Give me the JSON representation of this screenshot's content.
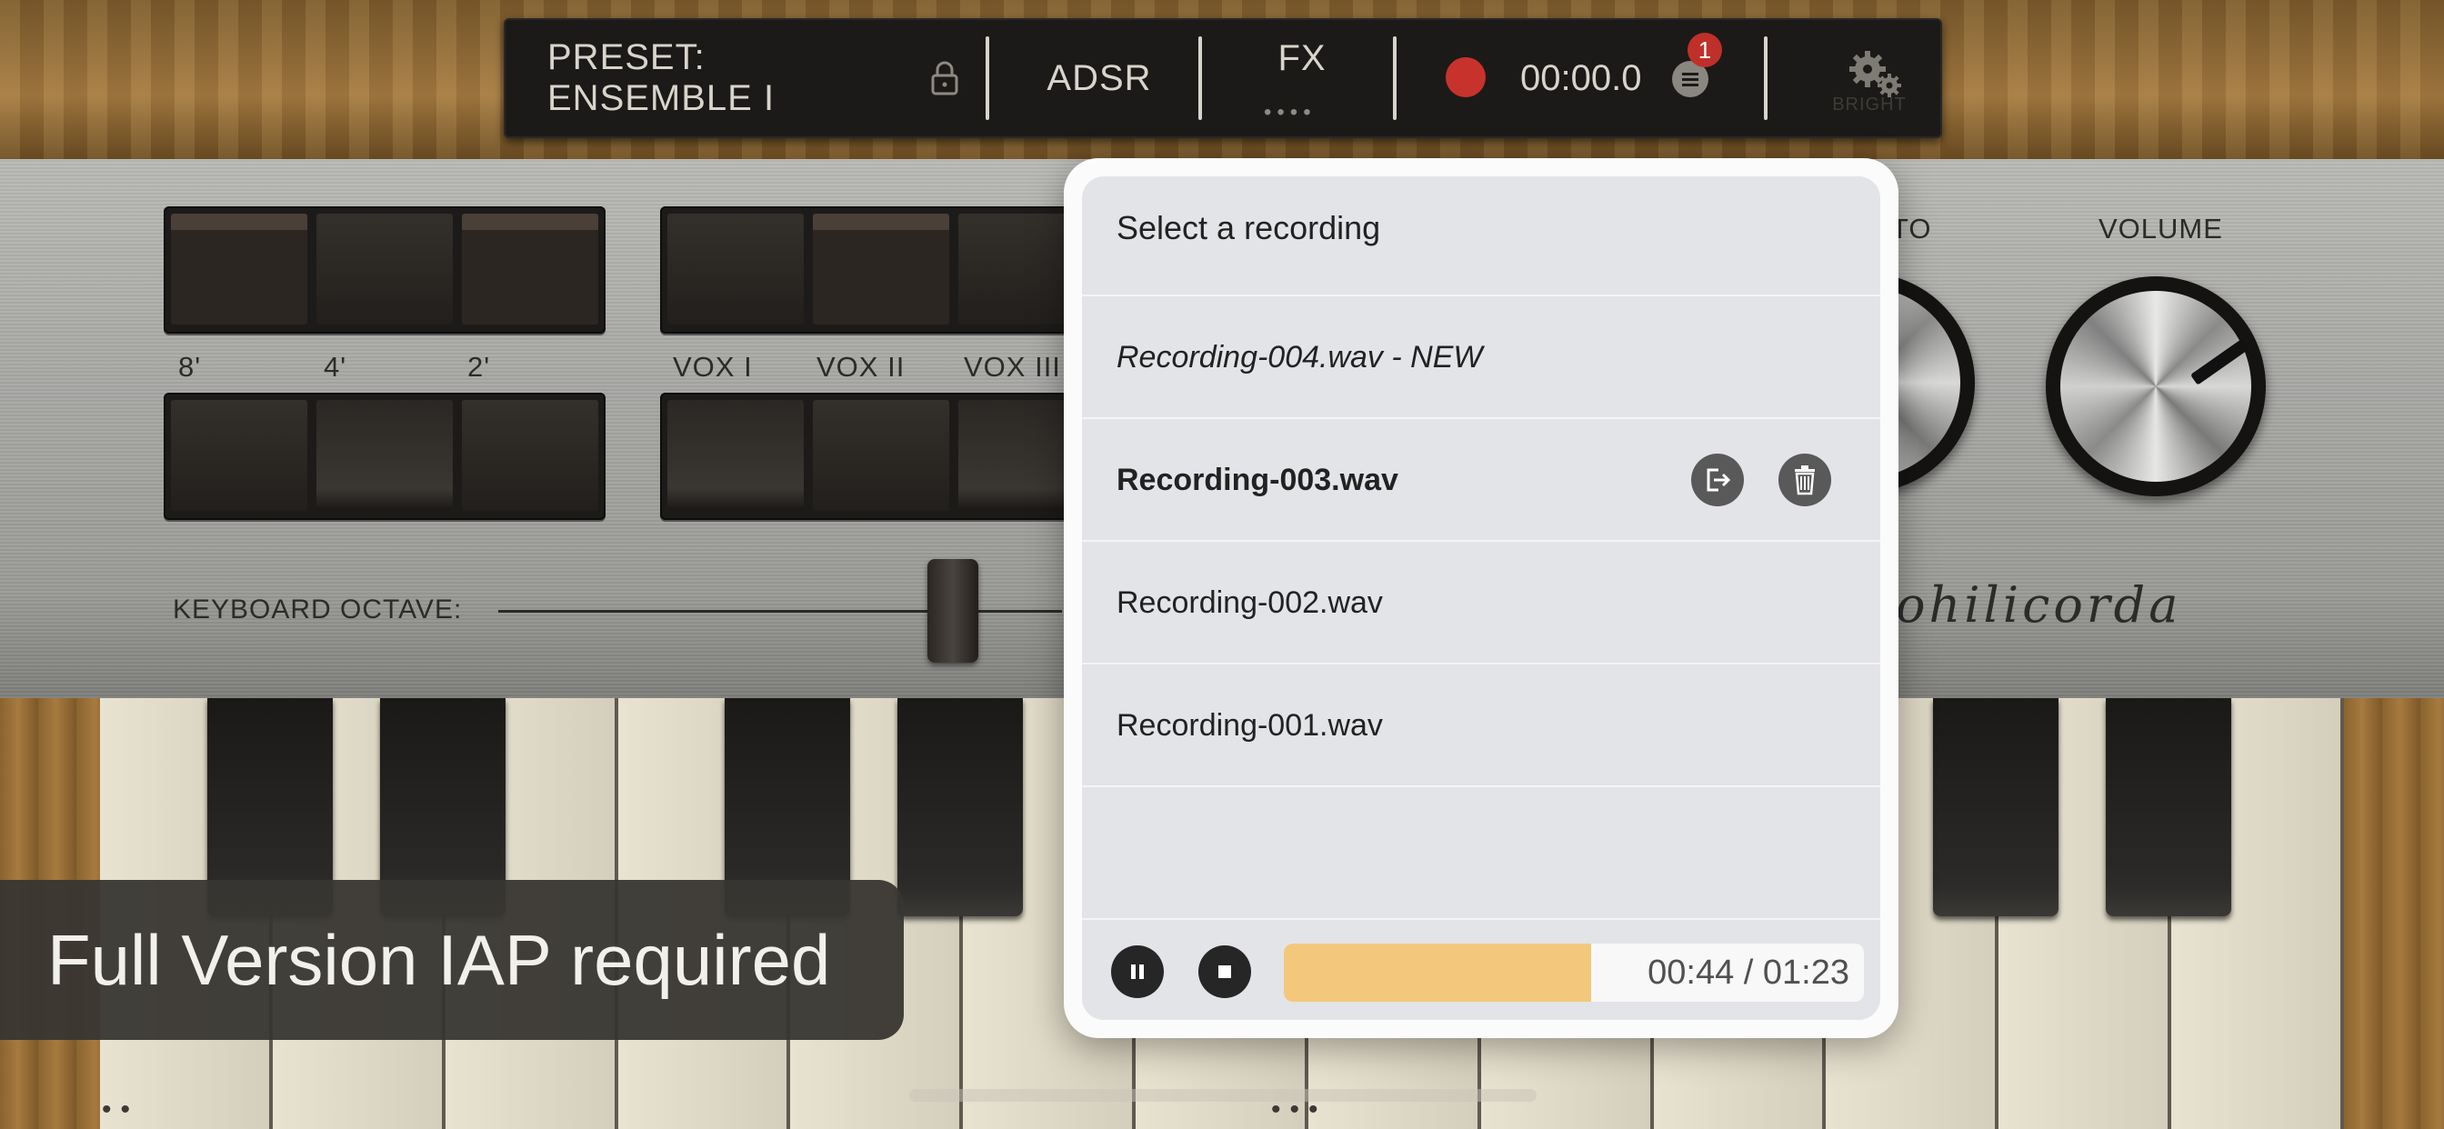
{
  "toolbar": {
    "preset_label": "PRESET: ENSEMBLE I",
    "adsr_label": "ADSR",
    "fx_label": "FX",
    "fx_dots": "••••",
    "timer": "00:00.0",
    "badge_count": "1",
    "bright_label": "BRIGHT"
  },
  "panel": {
    "row1_labels": [
      "8'",
      "4'",
      "2'"
    ],
    "vox_labels": [
      "VOX I",
      "VOX II",
      "VOX III"
    ],
    "octave_label": "KEYBOARD OCTAVE:",
    "vibrato_partial": "TO",
    "volume_label": "VOLUME",
    "brand": "ohilicorda"
  },
  "popover": {
    "title": "Select a recording",
    "recordings": [
      {
        "name": "Recording-004.wav - NEW",
        "style": "new"
      },
      {
        "name": "Recording-003.wav",
        "style": "selected"
      },
      {
        "name": "Recording-002.wav",
        "style": "normal"
      },
      {
        "name": "Recording-001.wav",
        "style": "normal"
      }
    ],
    "playback": {
      "progress_text": "00:44 / 01:23",
      "elapsed_seconds": 44,
      "total_seconds": 83
    }
  },
  "banner": {
    "text": "Full Version IAP required"
  },
  "colors": {
    "record_red": "#c8322c",
    "progress_fill": "#f3c87c",
    "badge_red": "#c0302a"
  }
}
